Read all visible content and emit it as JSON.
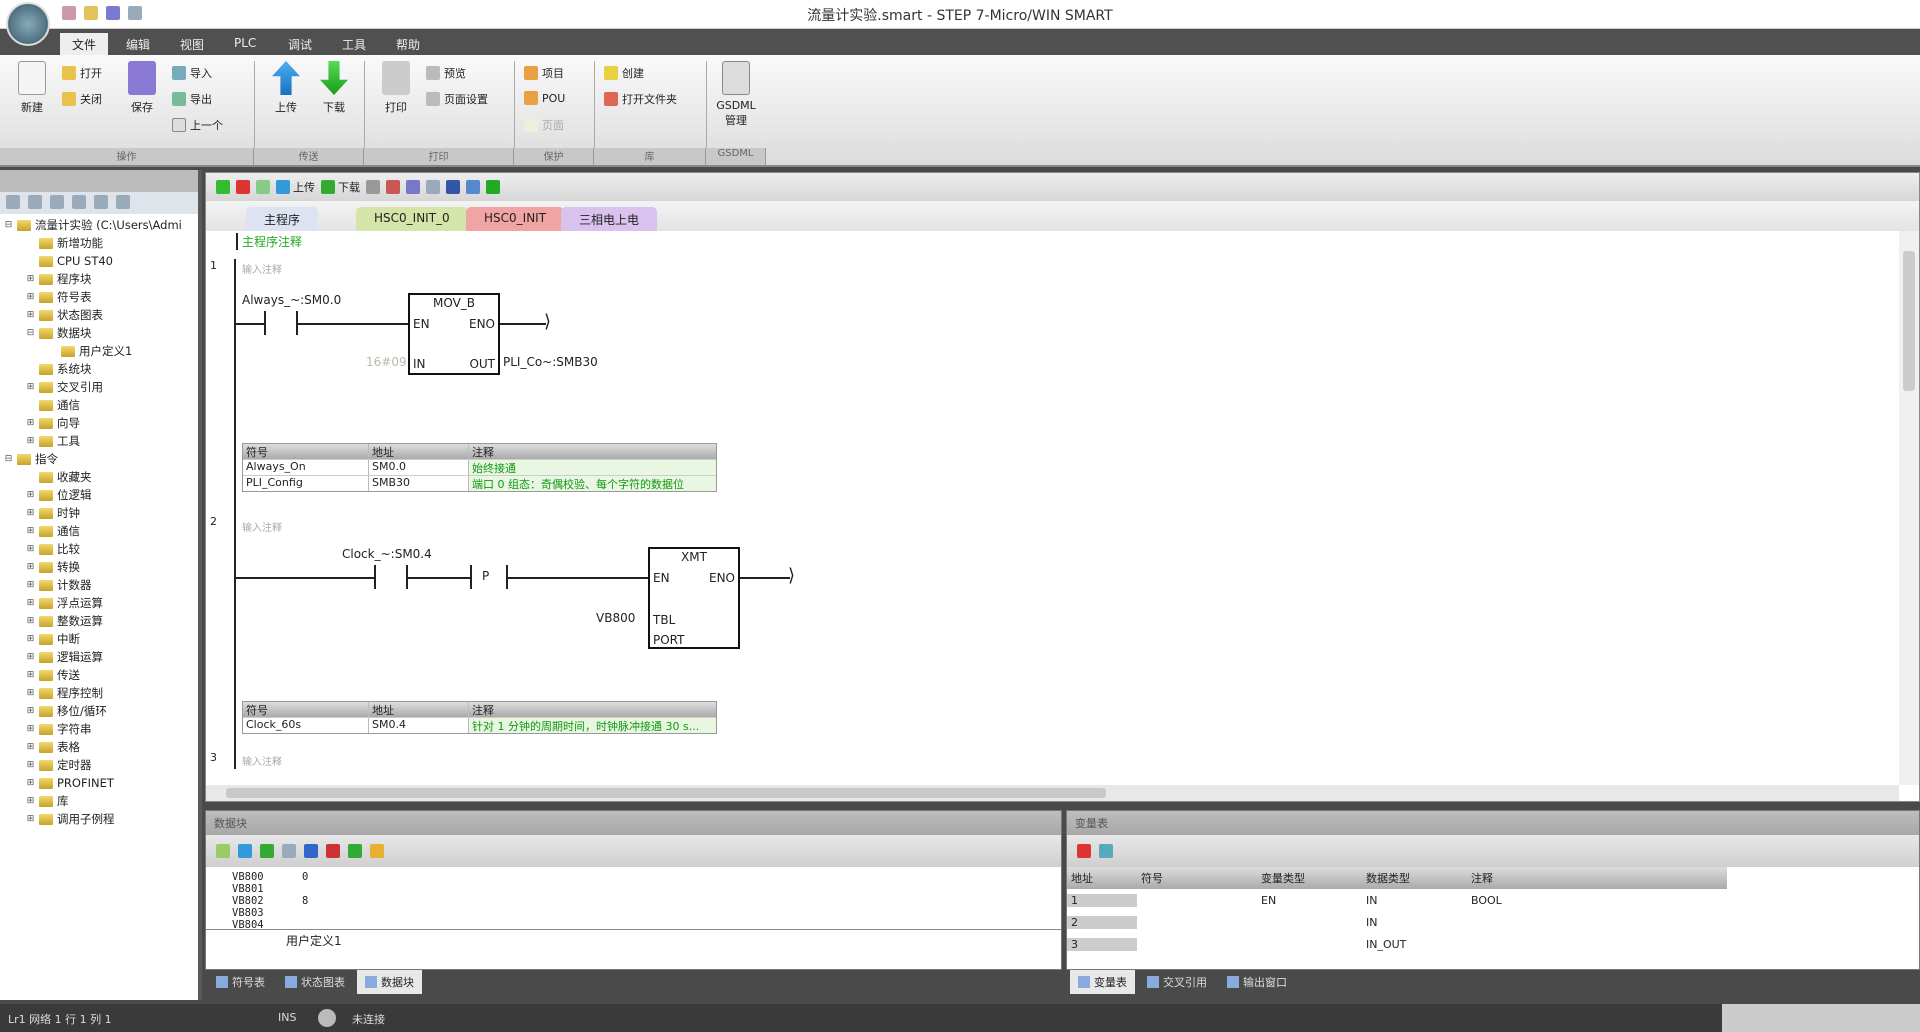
{
  "window": {
    "title": "流量计实验.smart - STEP 7-Micro/WIN SMART"
  },
  "ribbon": {
    "tabs": [
      "文件",
      "编辑",
      "视图",
      "PLC",
      "调试",
      "工具",
      "帮助"
    ],
    "active_tab": "文件",
    "buttons": {
      "new": "新建",
      "open": "打开",
      "close": "关闭",
      "save": "保存",
      "import": "导入",
      "export": "导出",
      "previous": "上一个",
      "upload": "上传",
      "download": "下载",
      "print": "打印",
      "preview": "预览",
      "page_setup": "页面设置",
      "project": "项目",
      "pou": "POU",
      "page": "页面",
      "create": "创建",
      "open_folder": "打开文件夹",
      "gsdml": "GSDML 管理"
    },
    "groups": [
      "操作",
      "传送",
      "打印",
      "保护",
      "库",
      "GSDML"
    ]
  },
  "project_tree": {
    "items": [
      {
        "label": "流量计实验 (C:\\Users\\Admi",
        "level": 0,
        "expander": "-"
      },
      {
        "label": "新增功能",
        "level": 1,
        "expander": ""
      },
      {
        "label": "CPU ST40",
        "level": 1,
        "expander": ""
      },
      {
        "label": "程序块",
        "level": 1,
        "expander": "+"
      },
      {
        "label": "符号表",
        "level": 1,
        "expander": "+"
      },
      {
        "label": "状态图表",
        "level": 1,
        "expander": "+"
      },
      {
        "label": "数据块",
        "level": 1,
        "expander": "-"
      },
      {
        "label": "用户定义1",
        "level": 2,
        "expander": ""
      },
      {
        "label": "系统块",
        "level": 1,
        "expander": ""
      },
      {
        "label": "交叉引用",
        "level": 1,
        "expander": "+"
      },
      {
        "label": "通信",
        "level": 1,
        "expander": ""
      },
      {
        "label": "向导",
        "level": 1,
        "expander": "+"
      },
      {
        "label": "工具",
        "level": 1,
        "expander": "+"
      },
      {
        "label": "指令",
        "level": 0,
        "expander": "-"
      },
      {
        "label": "收藏夹",
        "level": 1,
        "expander": ""
      },
      {
        "label": "位逻辑",
        "level": 1,
        "expander": "+"
      },
      {
        "label": "时钟",
        "level": 1,
        "expander": "+"
      },
      {
        "label": "通信",
        "level": 1,
        "expander": "+"
      },
      {
        "label": "比较",
        "level": 1,
        "expander": "+"
      },
      {
        "label": "转换",
        "level": 1,
        "expander": "+"
      },
      {
        "label": "计数器",
        "level": 1,
        "expander": "+"
      },
      {
        "label": "浮点运算",
        "level": 1,
        "expander": "+"
      },
      {
        "label": "整数运算",
        "level": 1,
        "expander": "+"
      },
      {
        "label": "中断",
        "level": 1,
        "expander": "+"
      },
      {
        "label": "逻辑运算",
        "level": 1,
        "expander": "+"
      },
      {
        "label": "传送",
        "level": 1,
        "expander": "+"
      },
      {
        "label": "程序控制",
        "level": 1,
        "expander": "+"
      },
      {
        "label": "移位/循环",
        "level": 1,
        "expander": "+"
      },
      {
        "label": "字符串",
        "level": 1,
        "expander": "+"
      },
      {
        "label": "表格",
        "level": 1,
        "expander": "+"
      },
      {
        "label": "定时器",
        "level": 1,
        "expander": "+"
      },
      {
        "label": "PROFINET",
        "level": 1,
        "expander": "+"
      },
      {
        "label": "库",
        "level": 1,
        "expander": "+"
      },
      {
        "label": "调用子例程",
        "level": 1,
        "expander": "+"
      }
    ]
  },
  "editor": {
    "toolbar": {
      "upload": "上传",
      "download": "下载"
    },
    "tabs": [
      {
        "label": "主程序",
        "color": "#dde3f0"
      },
      {
        "label": "HSC0_INIT_0",
        "color": "#d5e4a8"
      },
      {
        "label": "HSC0_INIT",
        "color": "#f1a4a4"
      },
      {
        "label": "三相电上电",
        "color": "#d9c3ee"
      }
    ],
    "program_comment": "主程序注释",
    "networks": [
      {
        "number": "1",
        "title": "输入注释",
        "contact": "Always_~:SM0.0",
        "box": {
          "name": "MOV_B",
          "en": "EN",
          "eno": "ENO",
          "in": "IN",
          "out": "OUT",
          "in_operand": "16#09",
          "out_operand": "PLI_Co~:SMB30"
        },
        "symbols": {
          "headers": [
            "符号",
            "地址",
            "注释"
          ],
          "rows": [
            [
              "Always_On",
              "SM0.0",
              "始终接通"
            ],
            [
              "PLI_Config",
              "SMB30",
              "端口 0 组态：奇偶校验、每个字符的数据位"
            ]
          ]
        }
      },
      {
        "number": "2",
        "title": "输入注释",
        "contact": "Clock_~:SM0.4",
        "edge": "P",
        "box": {
          "name": "XMT",
          "en": "EN",
          "eno": "ENO",
          "tbl": "TBL",
          "port": "PORT",
          "tbl_operand": "VB800"
        },
        "symbols": {
          "headers": [
            "符号",
            "地址",
            "注释"
          ],
          "rows": [
            [
              "Clock_60s",
              "SM0.4",
              "针对 1 分钟的周期时间，时钟脉冲接通 30 s..."
            ]
          ]
        }
      },
      {
        "number": "3",
        "title": "输入注释"
      }
    ]
  },
  "data_block": {
    "title": "数据块",
    "lines": [
      [
        "VB800",
        "0"
      ],
      [
        "VB801",
        ""
      ],
      [
        "VB802",
        "8"
      ],
      [
        "VB803",
        ""
      ],
      [
        "VB804",
        ""
      ]
    ],
    "tab": "用户定义1"
  },
  "variable_table": {
    "title": "变量表",
    "headers": [
      "地址",
      "符号",
      "变量类型",
      "数据类型",
      "注释"
    ],
    "rows": [
      [
        "1",
        "",
        "EN",
        "IN",
        "BOOL"
      ],
      [
        "2",
        "",
        "",
        "IN",
        ""
      ],
      [
        "3",
        "",
        "",
        "IN_OUT",
        ""
      ]
    ]
  },
  "bottom_tabs_left": [
    "符号表",
    "状态图表",
    "数据块"
  ],
  "bottom_tabs_right": [
    "变量表",
    "交叉引用",
    "输出窗口"
  ],
  "status": {
    "position": "Lr1 网络 1 行 1 列 1",
    "mode": "INS",
    "connection": "未连接"
  }
}
